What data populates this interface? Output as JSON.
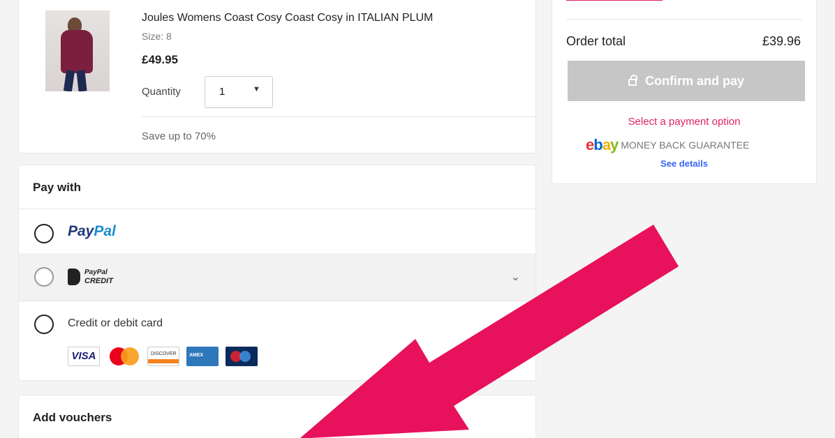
{
  "item": {
    "title": "Joules Womens Coast Cosy Coast Cosy in ITALIAN PLUM",
    "size": "Size: 8",
    "price": "£49.95",
    "quantity_label": "Quantity",
    "quantity_value": "1",
    "promo": "Save up to 70%"
  },
  "payment": {
    "heading": "Pay with",
    "options": {
      "paypal": {
        "word1": "Pay",
        "word2": "Pal"
      },
      "paypal_credit": {
        "line1": "PayPal",
        "line2": "CREDIT"
      },
      "card": {
        "label": "Credit or debit card"
      }
    },
    "card_brands": [
      "VISA",
      "Mastercard",
      "DISCOVER",
      "American Express",
      "Maestro"
    ]
  },
  "vouchers": {
    "heading": "Add vouchers"
  },
  "summary": {
    "order_total_label": "Order total",
    "order_total_value": "£39.96",
    "confirm_label": "Confirm and pay",
    "select_payment_msg": "Select a payment option",
    "guarantee_text": "MONEY BACK GUARANTEE",
    "see_details": "See details",
    "ebay_letters": [
      "e",
      "b",
      "a",
      "y"
    ]
  },
  "colors": {
    "accent_red": "#e0245e",
    "link_blue": "#3665f3",
    "button_disabled": "#c6c6c6",
    "arrow_pink": "#e8115b"
  }
}
